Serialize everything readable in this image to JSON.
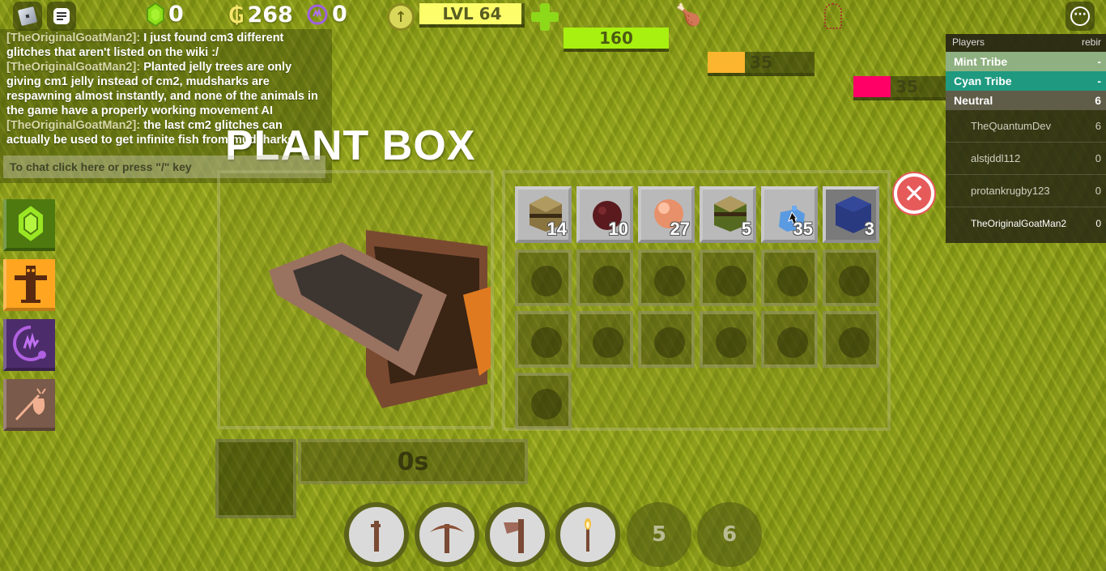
{
  "topbar": {
    "roblox_menu_icon": "roblox-logo-icon",
    "chat_toggle_icon": "chat-icon",
    "gems": "0",
    "coins": "268",
    "essence": "0",
    "level": {
      "label": "LVL 64",
      "fill_percent": 97
    },
    "health": {
      "value": "160",
      "fill_percent": 100
    },
    "hunger": {
      "value": "35",
      "fill_percent": 35
    },
    "temperature": {
      "value": "35",
      "fill_percent": 35
    },
    "more_menu_icon": "ellipsis-icon",
    "colors": {
      "level": "#fdfd6a",
      "health": "#a8f010",
      "hunger": "#fbb52e",
      "temperature": "#ff0066"
    }
  },
  "chat": {
    "messages": [
      {
        "author": "[TheOriginalGoatMan2]:",
        "text": "I just found cm3 different glitches that aren't listed on the wiki :/"
      },
      {
        "author": "[TheOriginalGoatMan2]:",
        "text": "Planted jelly trees are only giving cm1 jelly instead of cm2, mudsharks are respawning almost instantly, and none of the animals in the game have a properly working movement AI"
      },
      {
        "author": "[TheOriginalGoatMan2]:",
        "text": "the last cm2 glitches can actually be used to get infinite fish from mudsharks"
      }
    ],
    "input_placeholder": "To chat click here or press \"/\" key"
  },
  "side_menu": [
    {
      "name": "gem-shop",
      "icon": "gem-icon",
      "color": "#4e7a10"
    },
    {
      "name": "tribes",
      "icon": "totem-icon",
      "color": "#ffa520"
    },
    {
      "name": "emotes",
      "icon": "hand-swirl-icon",
      "color": "#4d2c6b"
    },
    {
      "name": "inventory-bag",
      "icon": "bindle-icon",
      "color": "#7a5a4a"
    }
  ],
  "plant_box": {
    "title": "PLANT BOX",
    "timer": "0s",
    "inventory": [
      {
        "item": "dirt-block",
        "count": "14"
      },
      {
        "item": "dark-red-ball",
        "count": "10"
      },
      {
        "item": "peach-ball",
        "count": "27"
      },
      {
        "item": "grass-block",
        "count": "5"
      },
      {
        "item": "blue-brick",
        "count": "35"
      },
      {
        "item": "blue-cube",
        "count": "3"
      }
    ],
    "empty_slots": 13
  },
  "leaderboard": {
    "header_players": "Players",
    "header_stat": "rebir",
    "teams": [
      {
        "name": "Mint Tribe",
        "value": "-",
        "color": "#8fb080"
      },
      {
        "name": "Cyan Tribe",
        "value": "-",
        "color": "#1f9a80"
      },
      {
        "name": "Neutral",
        "value": "6",
        "color": "#5f5c48"
      }
    ],
    "players": [
      {
        "name": "TheQuantumDev",
        "value": "6"
      },
      {
        "name": "alstjddl112",
        "value": "0"
      },
      {
        "name": "protankrugby123",
        "value": "0"
      },
      {
        "name": "TheOriginalGoatMan2",
        "value": "0"
      }
    ]
  },
  "hotbar": [
    {
      "slot": "1",
      "tool": "stick",
      "icon": "stick-icon"
    },
    {
      "slot": "2",
      "tool": "pickaxe",
      "icon": "pickaxe-icon"
    },
    {
      "slot": "3",
      "tool": "axe",
      "icon": "axe-icon"
    },
    {
      "slot": "4",
      "tool": "torch",
      "icon": "torch-icon"
    },
    {
      "slot": "5",
      "label": "5"
    },
    {
      "slot": "6",
      "label": "6"
    }
  ]
}
